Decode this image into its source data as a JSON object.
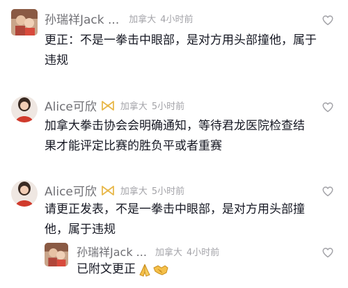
{
  "comments": [
    {
      "author": "孙瑞祥Jack ...",
      "location": "加拿大",
      "time": "4小时前",
      "text_lines": [
        "更正：不是一拳击中眼部，是对方用头部撞他，属于",
        "违规"
      ],
      "avatar_style": "photo-square",
      "liked": false
    },
    {
      "author": "Alice可欣",
      "badge_icon": "bow-badge-icon",
      "location": "加拿大",
      "time": "5小时前",
      "text_lines": [
        "加拿大拳击协会会明确通知，等待君龙医院检查结",
        "果才能评定比赛的胜负平或者重赛"
      ],
      "avatar_style": "photo-round",
      "liked": false
    },
    {
      "author": "Alice可欣",
      "badge_icon": "bow-badge-icon",
      "location": "加拿大",
      "time": "5小时前",
      "text_lines": [
        "请更正发表，不是一拳击中眼部，是对方用头部撞",
        "他，属于违规"
      ],
      "avatar_style": "photo-round",
      "liked": false
    }
  ],
  "reply": {
    "author": "孙瑞祥Jack ...",
    "location": "加拿大",
    "time": "4小时前",
    "text": "已附文更正",
    "emoji_icons": [
      "folded-hands-icon",
      "handshake-icon"
    ],
    "liked": false
  },
  "colors": {
    "name": "#6f6f74",
    "meta": "#a3a3a8",
    "text": "#161823",
    "badge": "#e8b84a"
  }
}
